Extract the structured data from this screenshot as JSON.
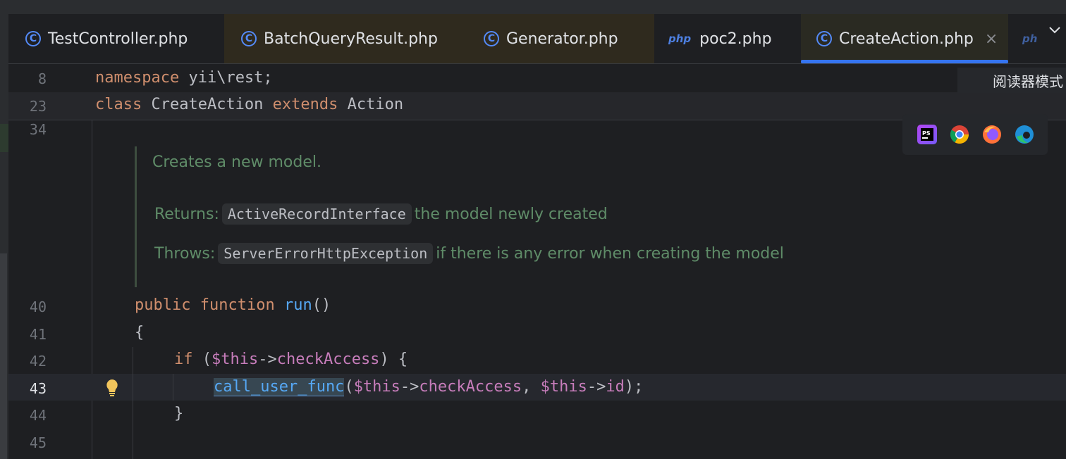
{
  "tabs": [
    {
      "label": "TestController.php",
      "icon": "c-class-icon"
    },
    {
      "label": "BatchQueryResult.php",
      "icon": "c-class-icon"
    },
    {
      "label": "Generator.php",
      "icon": "c-class-icon"
    },
    {
      "label": "poc2.php",
      "icon": "php-file-icon",
      "icon_text": "php"
    },
    {
      "label": "CreateAction.php",
      "icon": "c-class-icon",
      "active": true,
      "close": "×"
    },
    {
      "label": "",
      "icon": "php-file-icon",
      "icon_text": "ph"
    }
  ],
  "reader_mode": "阅读器模式",
  "sticky": {
    "line1": {
      "num": "8",
      "kw": "namespace",
      "rest": " yii\\rest;"
    },
    "line2": {
      "num": "23",
      "kw1": "class",
      "name": " CreateAction ",
      "kw2": "extends",
      "parent": " Action"
    }
  },
  "doc": {
    "summary": "Creates a new model.",
    "returns_label": "Returns:",
    "returns_type": "ActiveRecordInterface",
    "returns_text": "the model newly created",
    "throws_label": "Throws:",
    "throws_type": "ServerErrorHttpException",
    "throws_text": "if there is any error when creating the model"
  },
  "lines": {
    "l34": "34",
    "l40": "40",
    "l41": "41",
    "l42": "42",
    "l43": "43",
    "l44": "44",
    "l45": "45"
  },
  "code": {
    "public": "public",
    "function": "function",
    "run": "run",
    "parens": "()",
    "open_brace": "{",
    "if": "if",
    "if_open": " (",
    "this1": "$this",
    "arrow1": "->",
    "checkAccess1": "checkAccess",
    "if_close": ") {",
    "call": "call_user_func",
    "paren_open": "(",
    "this2": "$this",
    "arrow2": "->",
    "checkAccess2": "checkAccess",
    "comma": ", ",
    "this3": "$this",
    "arrow3": "->",
    "id": "id",
    "end": ");",
    "close_brace": "}"
  },
  "toolbar_icons": [
    "phpstorm-icon",
    "chrome-icon",
    "firefox-icon",
    "edge-icon"
  ],
  "colors": {
    "accent": "#3574f0",
    "keyword": "#cf8e6d",
    "function": "#56a8f5",
    "doc": "#5f8c68"
  }
}
